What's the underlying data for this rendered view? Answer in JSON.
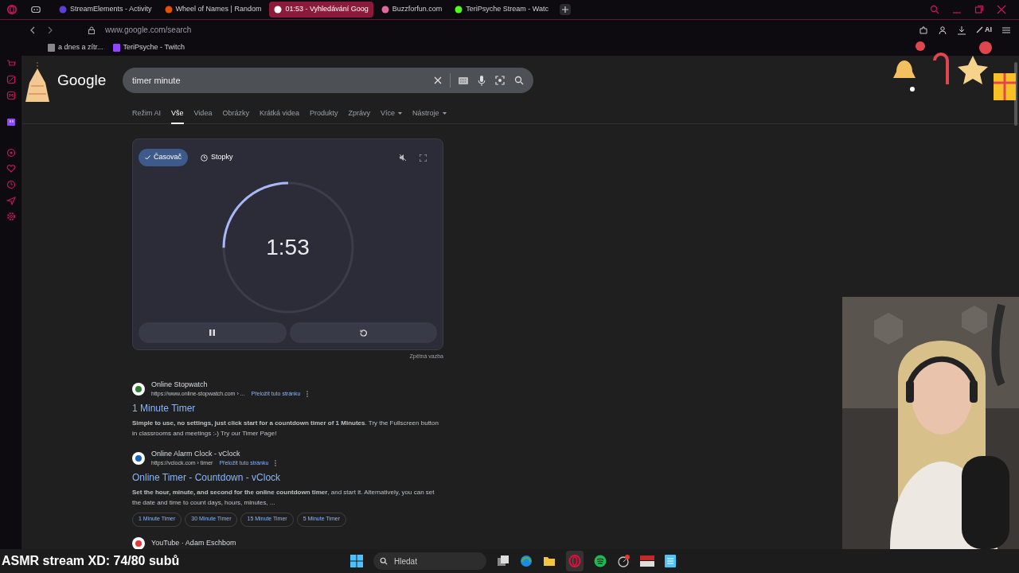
{
  "tabs": [
    {
      "label": "StreamElements - Activity",
      "selected": false
    },
    {
      "label": "Wheel of Names | Random",
      "selected": false
    },
    {
      "label": "01:53 - Vyhledávání Goog",
      "selected": true
    },
    {
      "label": "Buzzforfun.com",
      "selected": false
    },
    {
      "label": "TeriPsyche Stream - Watc",
      "selected": false
    }
  ],
  "address_bar": {
    "url": "www.google.com/search",
    "ai_button": "AI"
  },
  "bookmarks": [
    "a dnes a zítr...",
    "TeriPsyche - Twitch"
  ],
  "search": {
    "logo": "Google",
    "query": "timer minute"
  },
  "search_tabs": [
    {
      "label": "Režim AI",
      "selected": false
    },
    {
      "label": "Vše",
      "selected": true
    },
    {
      "label": "Videa",
      "selected": false
    },
    {
      "label": "Obrázky",
      "selected": false
    },
    {
      "label": "Krátká videa",
      "selected": false
    },
    {
      "label": "Produkty",
      "selected": false
    },
    {
      "label": "Zprávy",
      "selected": false
    },
    {
      "label": "Více",
      "selected": false,
      "dropdown": true
    },
    {
      "label": "Nástroje",
      "selected": false,
      "dropdown": true
    }
  ],
  "timer": {
    "modes": [
      {
        "label": "Časovač",
        "selected": true
      },
      {
        "label": "Stopky",
        "selected": false
      }
    ],
    "time": "1:53",
    "level": 0.25,
    "feedback": "Zpětná vazba"
  },
  "results": [
    {
      "site": "Online Stopwatch",
      "url": "https://www.online-stopwatch.com › ...",
      "translate": "Přeložit tuto stránku",
      "title": "1 Minute Timer",
      "snippet": "**Simple to use, no settings, just click start for a countdown timer of 1 Minutes**. Try the Fullscreen button in classrooms and meetings :-) Try our Timer Page!"
    },
    {
      "site": "Online Alarm Clock - vClock",
      "url": "https://vclock.com › timer",
      "translate": "Přeložit tuto stránku",
      "title": "Online Timer - Countdown - vClock",
      "snippet": "**Set the hour, minute, and second for the online countdown timer**, and start it. Alternatively, you can set the date and time to count days, hours, minutes, ...",
      "chips": [
        "1 Minute Timer",
        "30 Minute Timer",
        "15 Minute Timer",
        "5 Minute Timer"
      ]
    },
    {
      "site": "YouTube · Adam Eschbom"
    }
  ],
  "overlay_text": "ASMR stream XD: 74/80 subů",
  "taskbar": {
    "search_placeholder": "Hledat"
  }
}
